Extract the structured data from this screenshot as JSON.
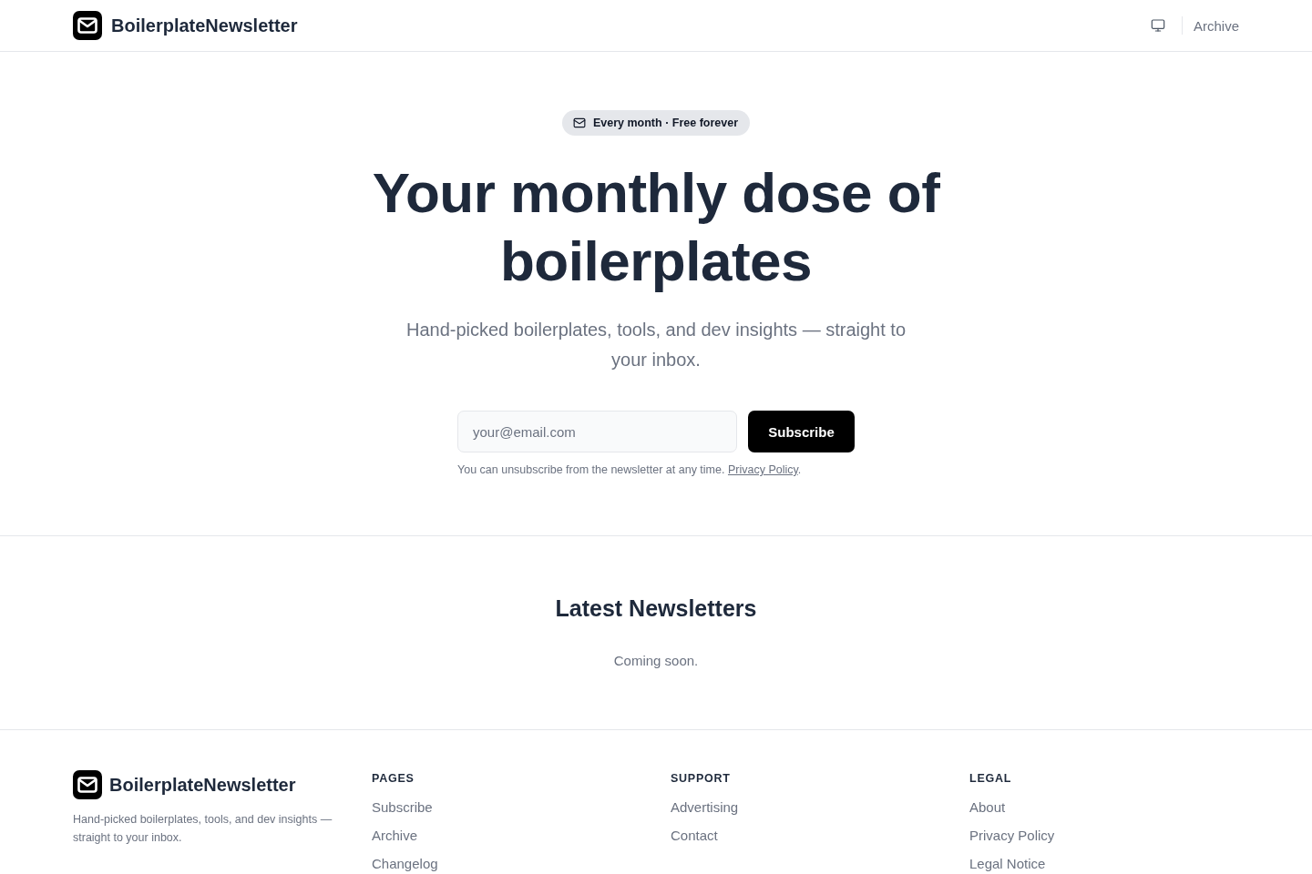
{
  "header": {
    "brand": "BoilerplateNewsletter",
    "nav_links": [
      "Archive"
    ]
  },
  "hero": {
    "badge": "Every month · Free forever",
    "title": "Your monthly dose of boilerplates",
    "subtitle": "Hand-picked boilerplates, tools, and dev insights — straight to your inbox.",
    "form": {
      "placeholder": "your@email.com",
      "button": "Subscribe"
    },
    "note": {
      "text": "You can unsubscribe from the newsletter at any time.",
      "link": "Privacy Policy",
      "after": "."
    }
  },
  "latest": {
    "title": "Latest Newsletters",
    "empty_text": "Coming soon."
  },
  "footer": {
    "brand": "BoilerplateNewsletter",
    "tagline": "Hand-picked boilerplates, tools, and dev insights — straight to your inbox.",
    "columns": [
      {
        "heading": "PAGES",
        "links": [
          "Subscribe",
          "Archive",
          "Changelog"
        ]
      },
      {
        "heading": "SUPPORT",
        "links": [
          "Advertising",
          "Contact"
        ]
      },
      {
        "heading": "LEGAL",
        "links": [
          "About",
          "Privacy Policy",
          "Legal Notice"
        ]
      }
    ]
  }
}
